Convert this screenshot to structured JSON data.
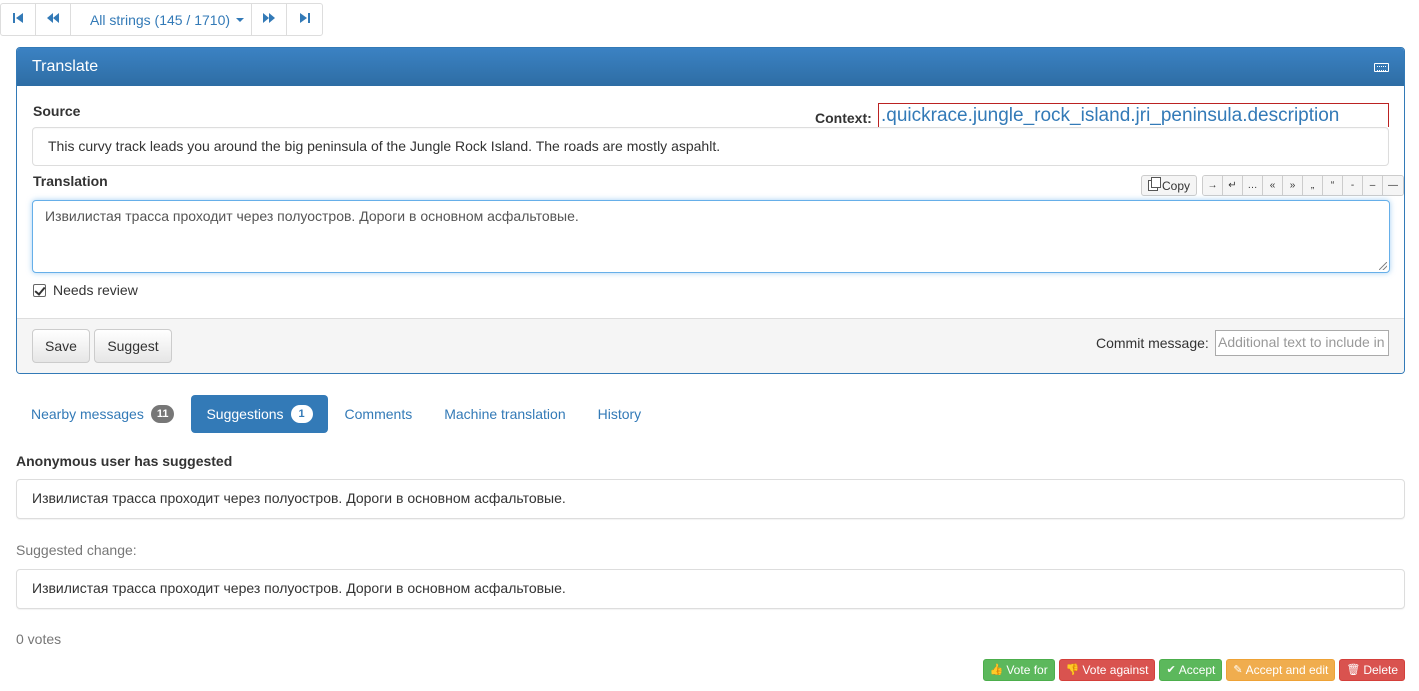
{
  "pager": {
    "first_icon": "first-icon",
    "prev_icon": "previous-icon",
    "position_label": "All strings (145 / 1710)",
    "next_icon": "next-icon",
    "last_icon": "last-icon"
  },
  "panel": {
    "title": "Translate",
    "source_label": "Source",
    "context_label": "Context:",
    "context_value": ".quickrace.jungle_rock_island.jri_peninsula.description",
    "source_text": "This curvy track leads you around the big peninsula of the Jungle Rock Island. The roads are mostly aspahlt.",
    "translation_label": "Translation",
    "copy_label": "Copy",
    "special_chars": [
      "→",
      "↵",
      "…",
      "«",
      "»",
      "„",
      "“",
      "‑",
      "–",
      "—"
    ],
    "translation_text": "Извилистая трасса проходит через полуостров. Дороги в основном асфальтовые.",
    "needs_review_label": "Needs review",
    "save_label": "Save",
    "suggest_label": "Suggest",
    "commit_label": "Commit message:",
    "commit_placeholder": "Additional text to include in"
  },
  "tabs": [
    {
      "label": "Nearby messages",
      "badge": "11"
    },
    {
      "label": "Suggestions",
      "badge": "1"
    },
    {
      "label": "Comments"
    },
    {
      "label": "Machine translation"
    },
    {
      "label": "History"
    }
  ],
  "suggestion": {
    "heading": "Anonymous user has suggested",
    "text": "Извилистая трасса проходит через полуостров. Дороги в основном асфальтовые.",
    "change_label": "Suggested change:",
    "change_text": "Извилистая трасса проходит через полуостров. Дороги в основном асфальтовые.",
    "votes": "0 votes",
    "vote_for": "Vote for",
    "vote_against": "Vote against",
    "accept": "Accept",
    "accept_edit": "Accept and edit",
    "delete": "Delete"
  },
  "colors": {
    "primary": "#337ab7",
    "success": "#5cb85c",
    "danger": "#d9534f",
    "warning": "#f0ad4e",
    "context_border": "#b22222"
  }
}
